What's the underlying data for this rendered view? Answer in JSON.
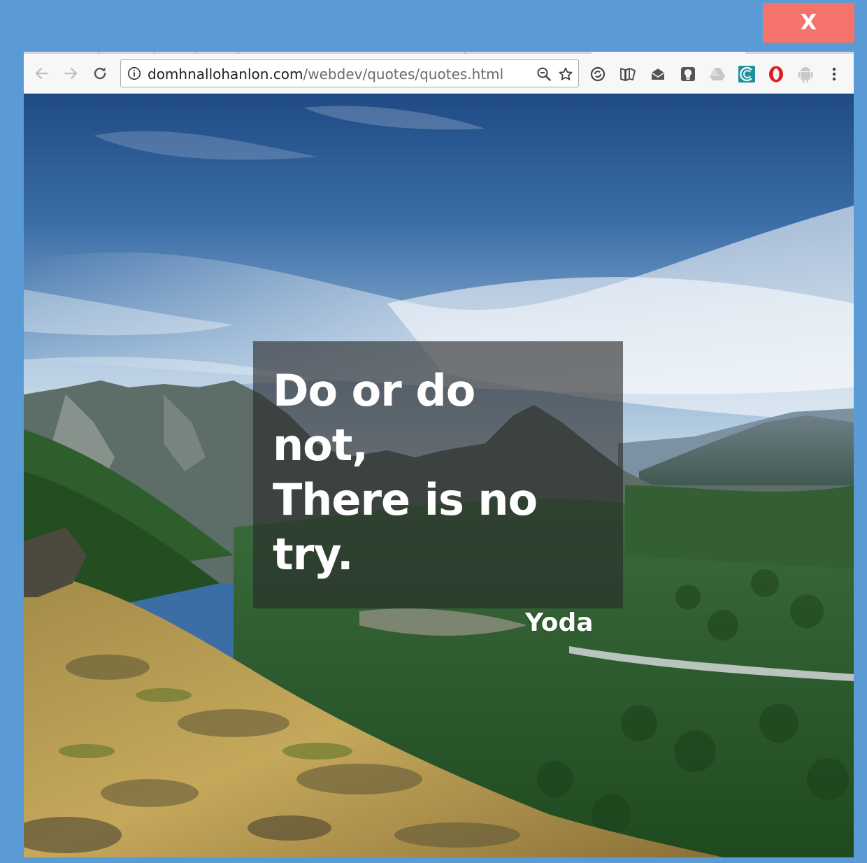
{
  "window": {
    "close_label": "X"
  },
  "toolbar": {
    "back_icon": "arrow-left-icon",
    "forward_icon": "arrow-right-icon",
    "reload_icon": "reload-icon",
    "url_domain": "domhnallohanlon.com",
    "url_path": "/webdev/quotes/quotes.html",
    "zoom_icon": "zoom-out-icon",
    "bookmark_icon": "star-icon",
    "menu_icon": "more-vertical-icon"
  },
  "extensions": [
    "sync-extension-icon",
    "book-extension-icon",
    "mail-extension-icon",
    "lightbulb-extension-icon",
    "drive-extension-icon",
    "wave-extension-icon",
    "opera-extension-icon",
    "android-extension-icon"
  ],
  "quote": {
    "line1": "Do or do",
    "line2": "not,",
    "line3": "There is no",
    "line4": "try.",
    "author": "Yoda"
  },
  "colors": {
    "frame": "#5b9bd5",
    "close_button": "#f4736b",
    "quote_panel": "#282828"
  }
}
